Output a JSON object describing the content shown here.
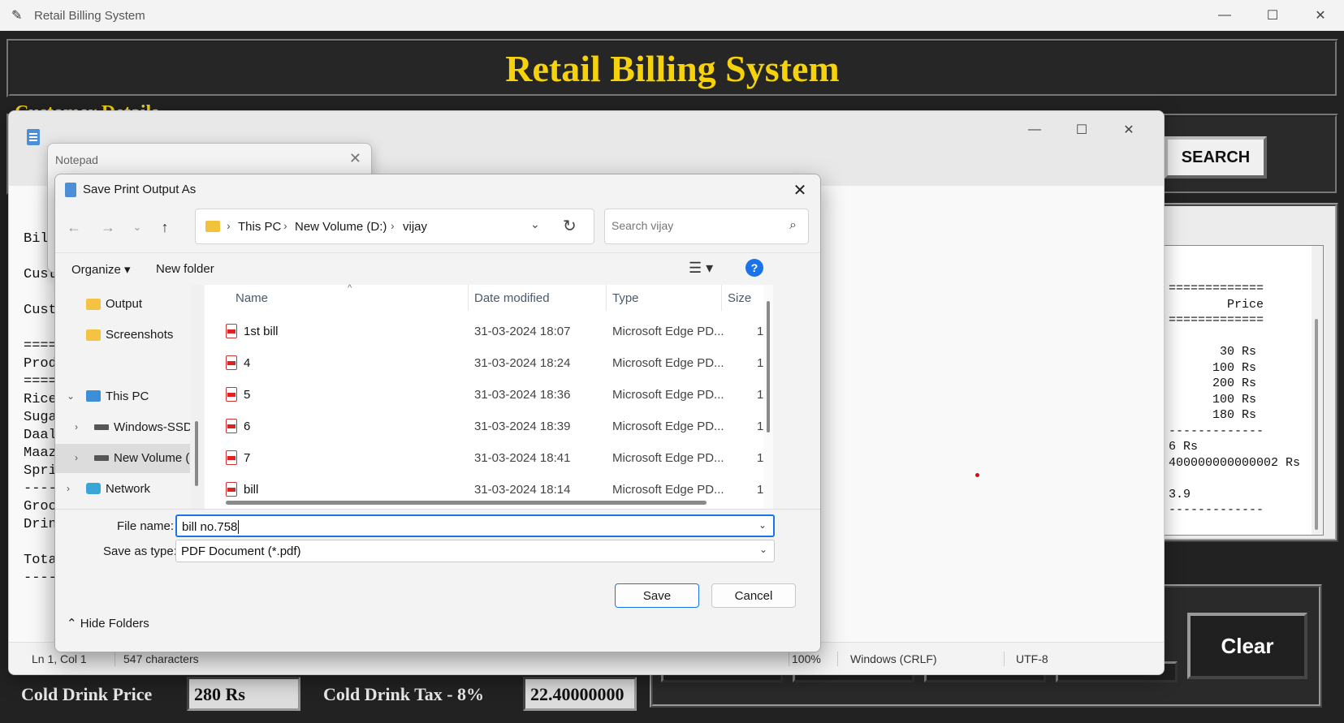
{
  "app": {
    "window_title": "Retail Billing System",
    "banner_title": "Retail Billing System",
    "section_label": "Customer Details",
    "search_label": "SEARCH",
    "clear_label": "Clear",
    "bill_lines": [
      "=============",
      "        Price",
      "=============",
      "",
      "       30 Rs",
      "      100 Rs",
      "      200 Rs",
      "      100 Rs",
      "      180 Rs",
      "-------------",
      "6 Rs",
      "400000000000002 Rs",
      "",
      "3.9",
      "-------------"
    ],
    "cold_drink_price_label": "Cold Drink Price",
    "cold_drink_price_value": "280 Rs",
    "cold_drink_tax_label": "Cold Drink Tax - 8%",
    "cold_drink_tax_value": "22.40000000"
  },
  "notepad": {
    "text_lines": [
      "Bil",
      "",
      "Cust",
      "",
      "Cust",
      "",
      "====",
      "Prod",
      "====",
      "Rice",
      "Suga",
      "Daal",
      "Maaz",
      "Spri",
      "----",
      "Groc",
      "Drin",
      "",
      "Tota",
      "----"
    ],
    "status": {
      "position": "Ln 1, Col 1",
      "chars": "547 characters",
      "zoom": "100%",
      "line_ending": "Windows (CRLF)",
      "encoding": "UTF-8"
    }
  },
  "print_dialog": {
    "title": "Notepad"
  },
  "save_dialog": {
    "title": "Save Print Output As",
    "breadcrumbs": [
      "This PC",
      "New Volume (D:)",
      "vijay"
    ],
    "search_placeholder": "Search vijay",
    "organize_label": "Organize",
    "new_folder_label": "New folder",
    "nav_items": [
      {
        "label": "Output"
      },
      {
        "label": "Screenshots"
      },
      {
        "label": "This PC"
      },
      {
        "label": "Windows-SSD"
      },
      {
        "label": "New Volume (D:)"
      },
      {
        "label": "Network"
      }
    ],
    "columns": [
      "Name",
      "Date modified",
      "Type",
      "Size"
    ],
    "files": [
      {
        "name": "1st bill",
        "date": "31-03-2024 18:07",
        "type": "Microsoft Edge PD...",
        "size": "1"
      },
      {
        "name": "4",
        "date": "31-03-2024 18:24",
        "type": "Microsoft Edge PD...",
        "size": "1"
      },
      {
        "name": "5",
        "date": "31-03-2024 18:36",
        "type": "Microsoft Edge PD...",
        "size": "1"
      },
      {
        "name": "6",
        "date": "31-03-2024 18:39",
        "type": "Microsoft Edge PD...",
        "size": "1"
      },
      {
        "name": "7",
        "date": "31-03-2024 18:41",
        "type": "Microsoft Edge PD...",
        "size": "1"
      },
      {
        "name": "bill",
        "date": "31-03-2024 18:14",
        "type": "Microsoft Edge PD...",
        "size": "1"
      }
    ],
    "file_name_label": "File name:",
    "file_name_value": "bill no.758",
    "save_type_label": "Save as type:",
    "save_type_value": "PDF Document (*.pdf)",
    "hide_folders_label": "Hide Folders",
    "save_label": "Save",
    "cancel_label": "Cancel"
  }
}
